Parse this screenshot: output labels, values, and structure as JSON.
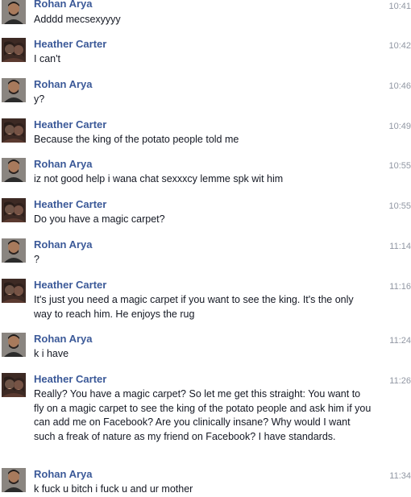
{
  "participants": {
    "rohan": {
      "name": "Rohan Arya",
      "avatar": "rohan-avatar"
    },
    "heather": {
      "name": "Heather Carter",
      "avatar": "heather-avatar"
    }
  },
  "messages": [
    {
      "sender": "Rohan Arya",
      "time": "10:41",
      "text": "Adddd mecsexyyyy"
    },
    {
      "sender": "Heather Carter",
      "time": "10:42",
      "text": "I can't"
    },
    {
      "sender": "Rohan Arya",
      "time": "10:46",
      "text": "y?"
    },
    {
      "sender": "Heather Carter",
      "time": "10:49",
      "text": "Because the king of the potato people told me"
    },
    {
      "sender": "Rohan Arya",
      "time": "10:55",
      "text": "iz not good help i wana chat sexxxcy lemme spk wit him"
    },
    {
      "sender": "Heather Carter",
      "time": "10:55",
      "text": "Do you have a magic carpet?"
    },
    {
      "sender": "Rohan Arya",
      "time": "11:14",
      "text": "?"
    },
    {
      "sender": "Heather Carter",
      "time": "11:16",
      "text": "It's just you need a magic carpet if you want to see the king. It's the only way to reach him. He enjoys the rug"
    },
    {
      "sender": "Rohan Arya",
      "time": "11:24",
      "text": "k i have"
    },
    {
      "sender": "Heather Carter",
      "time": "11:26",
      "text": "Really? You have a magic carpet? So let me get this straight: You want to fly on a magic carpet to see the king of the potato people and ask him if you can add me on Facebook? Are you clinically insane? Why would I want such a freak of nature as my friend on Facebook? I have standards."
    },
    {
      "sender": "Rohan Arya",
      "time": "11:34",
      "text": "k fuck u bitch i fuck u and ur mother"
    }
  ]
}
